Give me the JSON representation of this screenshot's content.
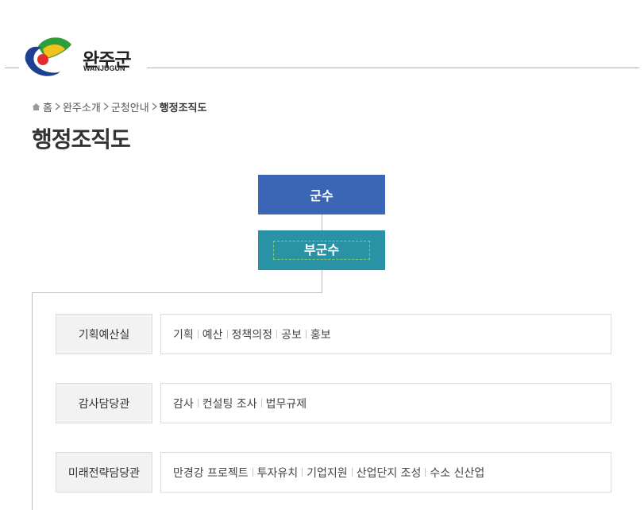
{
  "header": {
    "logo_name": "완주군",
    "logo_sub": "WANJUGUN"
  },
  "breadcrumb": {
    "items": [
      "홈",
      "완주소개",
      "군청안내"
    ],
    "current": "행정조직도"
  },
  "page_title": "행정조직도",
  "org": {
    "mayor": "군수",
    "vice_mayor": "부군수",
    "departments": [
      {
        "name": "기획예산실",
        "tasks": [
          "기획 ",
          "예산",
          "정책의정",
          "공보",
          "홍보"
        ]
      },
      {
        "name": "감사담당관",
        "tasks": [
          "감사 ",
          "컨설팅 조사",
          "법무규제"
        ]
      },
      {
        "name": "미래전략담당관",
        "tasks": [
          "만경강 프로젝트 ",
          "투자유치",
          "기업지원",
          "산업단지 조성",
          "수소 신산업"
        ]
      }
    ]
  },
  "colors": {
    "mayor_box": "#3a66b5",
    "vice_box": "#2993a5",
    "header_line": "#e0a25c"
  }
}
